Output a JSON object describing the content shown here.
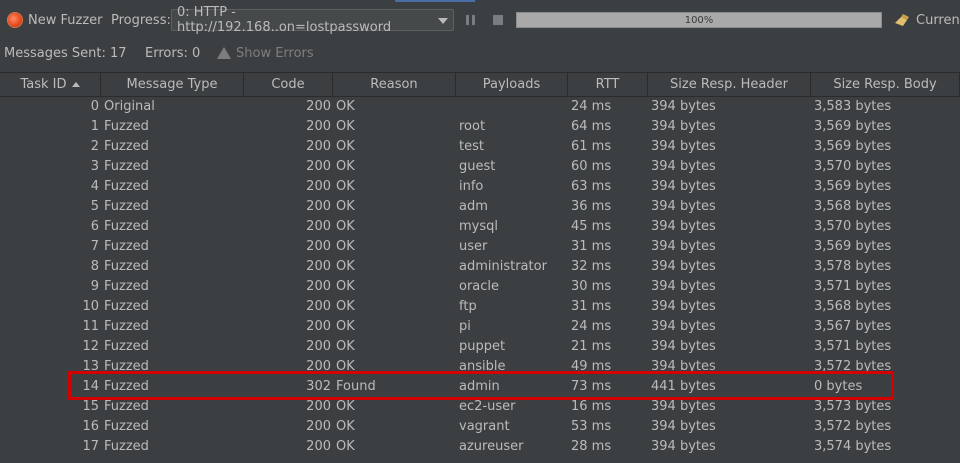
{
  "toolbar": {
    "new_fuzzer_label": "New Fuzzer",
    "progress_label": "Progress:",
    "progress_select_value": "0: HTTP - http://192.168..on=lostpassword",
    "progress_percent_text": "100%",
    "progress_fraction": 1.0,
    "current_label": "Current"
  },
  "status": {
    "messages_sent": "Messages Sent: 17",
    "errors": "Errors: 0",
    "show_errors": "Show Errors"
  },
  "table": {
    "columns": [
      "Task ID",
      "Message Type",
      "Code",
      "Reason",
      "Payloads",
      "RTT",
      "Size Resp. Header",
      "Size Resp. Body"
    ],
    "rows": [
      [
        "0",
        "Original",
        "200",
        "OK",
        "",
        "24 ms",
        "394 bytes",
        "3,583 bytes"
      ],
      [
        "1",
        "Fuzzed",
        "200",
        "OK",
        "root",
        "64 ms",
        "394 bytes",
        "3,569 bytes"
      ],
      [
        "2",
        "Fuzzed",
        "200",
        "OK",
        "test",
        "61 ms",
        "394 bytes",
        "3,569 bytes"
      ],
      [
        "3",
        "Fuzzed",
        "200",
        "OK",
        "guest",
        "60 ms",
        "394 bytes",
        "3,570 bytes"
      ],
      [
        "4",
        "Fuzzed",
        "200",
        "OK",
        "info",
        "63 ms",
        "394 bytes",
        "3,569 bytes"
      ],
      [
        "5",
        "Fuzzed",
        "200",
        "OK",
        "adm",
        "36 ms",
        "394 bytes",
        "3,568 bytes"
      ],
      [
        "6",
        "Fuzzed",
        "200",
        "OK",
        "mysql",
        "45 ms",
        "394 bytes",
        "3,570 bytes"
      ],
      [
        "7",
        "Fuzzed",
        "200",
        "OK",
        "user",
        "31 ms",
        "394 bytes",
        "3,569 bytes"
      ],
      [
        "8",
        "Fuzzed",
        "200",
        "OK",
        "administrator",
        "32 ms",
        "394 bytes",
        "3,578 bytes"
      ],
      [
        "9",
        "Fuzzed",
        "200",
        "OK",
        "oracle",
        "30 ms",
        "394 bytes",
        "3,571 bytes"
      ],
      [
        "10",
        "Fuzzed",
        "200",
        "OK",
        "ftp",
        "31 ms",
        "394 bytes",
        "3,568 bytes"
      ],
      [
        "11",
        "Fuzzed",
        "200",
        "OK",
        "pi",
        "24 ms",
        "394 bytes",
        "3,567 bytes"
      ],
      [
        "12",
        "Fuzzed",
        "200",
        "OK",
        "puppet",
        "21 ms",
        "394 bytes",
        "3,571 bytes"
      ],
      [
        "13",
        "Fuzzed",
        "200",
        "OK",
        "ansible",
        "49 ms",
        "394 bytes",
        "3,572 bytes"
      ],
      [
        "14",
        "Fuzzed",
        "302",
        "Found",
        "admin",
        "73 ms",
        "441 bytes",
        "0 bytes"
      ],
      [
        "15",
        "Fuzzed",
        "200",
        "OK",
        "ec2-user",
        "16 ms",
        "394 bytes",
        "3,573 bytes"
      ],
      [
        "16",
        "Fuzzed",
        "200",
        "OK",
        "vagrant",
        "53 ms",
        "394 bytes",
        "3,572 bytes"
      ],
      [
        "17",
        "Fuzzed",
        "200",
        "OK",
        "azureuser",
        "28 ms",
        "394 bytes",
        "3,574 bytes"
      ]
    ],
    "highlighted_task_id": "14",
    "highlight_color": "#d40000"
  },
  "icons": {
    "new_fuzzer": "fuzzer-icon",
    "pause": "pause-icon",
    "stop": "stop-icon",
    "current": "broom-icon",
    "warning": "warning-icon",
    "sort": "sort-ascending-icon"
  }
}
